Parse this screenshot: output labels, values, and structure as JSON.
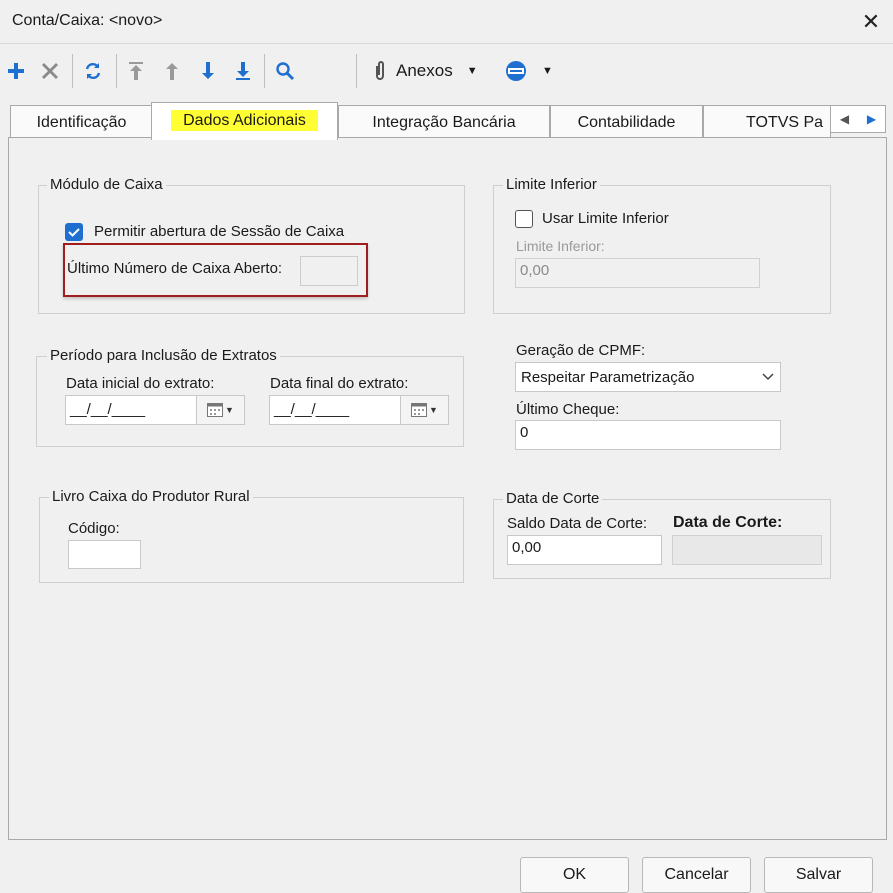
{
  "window": {
    "title": "Conta/Caixa: <novo>",
    "close_icon": "close-icon"
  },
  "toolbar": {
    "anexos_label": "Anexos",
    "icons": [
      "add-icon",
      "delete-icon",
      "refresh-icon",
      "first-icon",
      "previous-icon",
      "next-icon",
      "last-icon",
      "search-icon",
      "attachment-icon",
      "dropdown-icon",
      "service-icon"
    ],
    "accent": "#1f6fd1"
  },
  "tabs": [
    {
      "label": "Identificação"
    },
    {
      "label": "Dados Adicionais",
      "active": true
    },
    {
      "label": "Integração Bancária"
    },
    {
      "label": "Contabilidade"
    },
    {
      "label": "TOTVS Pa"
    }
  ],
  "modulo_caixa": {
    "legend": "Módulo de Caixa",
    "permitir_label": "Permitir abertura de Sessão de Caixa",
    "permitir_checked": true,
    "ultimo_numero_label": "Último Número de Caixa Aberto:",
    "ultimo_numero_value": ""
  },
  "limite_inferior": {
    "legend": "Limite Inferior",
    "usar_label": "Usar Limite Inferior",
    "usar_checked": false,
    "limite_label": "Limite Inferior:",
    "limite_value": "0,00"
  },
  "periodo": {
    "legend": "Período para Inclusão de Extratos",
    "data_inicial_label": "Data inicial do extrato:",
    "data_inicial_value": "__/__/____",
    "data_final_label": "Data final do extrato:",
    "data_final_value": "__/__/____"
  },
  "cpmf": {
    "geracao_label": "Geração de CPMF:",
    "geracao_value": "Respeitar Parametrização",
    "ultimo_cheque_label": "Último Cheque:",
    "ultimo_cheque_value": "0"
  },
  "livro_caixa": {
    "legend": "Livro Caixa do Produtor Rural",
    "codigo_label": "Código:",
    "codigo_value": ""
  },
  "data_corte": {
    "legend": "Data de Corte",
    "saldo_label": "Saldo Data de Corte:",
    "saldo_value": "0,00",
    "data_label": "Data de Corte:",
    "data_value": ""
  },
  "buttons": {
    "ok": "OK",
    "cancel": "Cancelar",
    "save": "Salvar"
  }
}
